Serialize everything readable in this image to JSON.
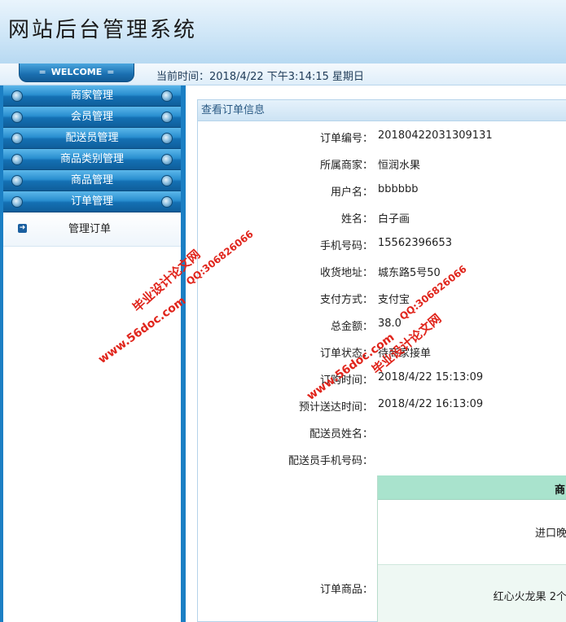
{
  "header": {
    "title": "网站后台管理系统"
  },
  "welcome_bar": {
    "tab_label": "WELCOME",
    "tab_dot": "=",
    "time_text": "当前时间：2018/4/22 下午3:14:15 星期日"
  },
  "sidebar": {
    "items": [
      {
        "label": "商家管理"
      },
      {
        "label": "会员管理"
      },
      {
        "label": "配送员管理"
      },
      {
        "label": "商品类别管理"
      },
      {
        "label": "商品管理"
      },
      {
        "label": "订单管理"
      }
    ],
    "submenu": {
      "label": "管理订单"
    }
  },
  "panel": {
    "title": "查看订单信息",
    "fields": [
      {
        "label": "订单编号：",
        "value": "20180422031309131"
      },
      {
        "label": "所属商家：",
        "value": "恒润水果"
      },
      {
        "label": "用户名：",
        "value": "bbbbbb"
      },
      {
        "label": "姓名：",
        "value": "白子画"
      },
      {
        "label": "手机号码：",
        "value": "15562396653"
      },
      {
        "label": "收货地址：",
        "value": "城东路5号50"
      },
      {
        "label": "支付方式：",
        "value": "支付宝"
      },
      {
        "label": "总金额：",
        "value": "38.0"
      },
      {
        "label": "订单状态：",
        "value": "待商家接单"
      },
      {
        "label": "订购时间：",
        "value": "2018/4/22 15:13:09"
      },
      {
        "label": "预计送达时间：",
        "value": "2018/4/22 16:13:09"
      },
      {
        "label": "配送员姓名：",
        "value": ""
      },
      {
        "label": "配送员手机号码：",
        "value": ""
      }
    ],
    "goods_label": "订单商品：",
    "goods_header": "商",
    "goods_rows": [
      "进口晚",
      "红心火龙果 2个"
    ]
  },
  "watermarks": {
    "site": "www.56doc.com",
    "name": "毕业设计论文网",
    "qq": "QQ:306826066"
  }
}
